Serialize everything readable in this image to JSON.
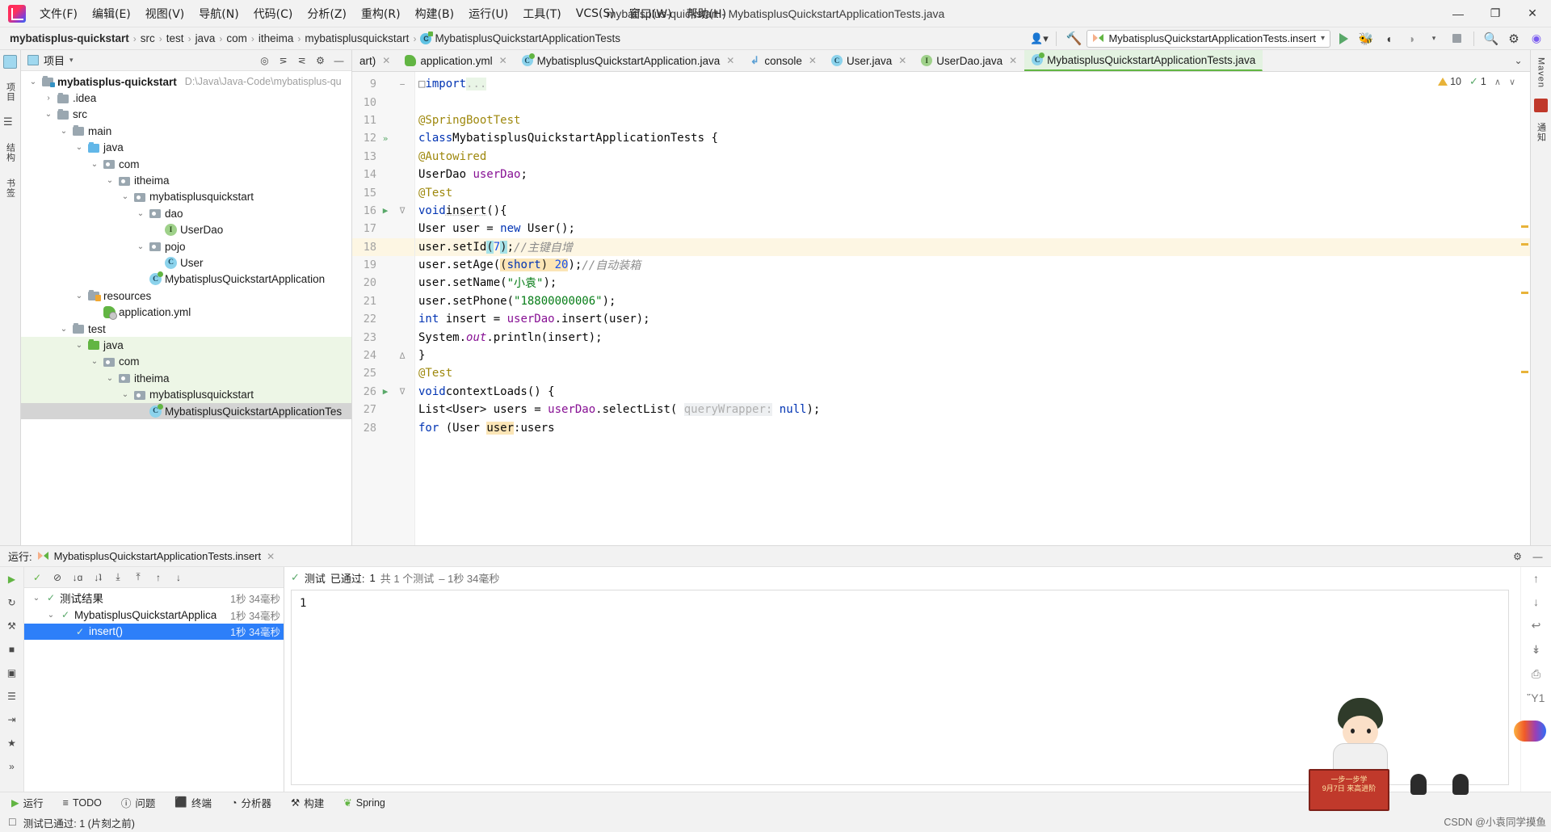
{
  "window": {
    "title": "mybatisplus-quickstart - MybatisplusQuickstartApplicationTests.java",
    "minimize": "—",
    "maximize": "❐",
    "close": "✕"
  },
  "menubar": {
    "items": [
      {
        "label": "文件(F)"
      },
      {
        "label": "编辑(E)"
      },
      {
        "label": "视图(V)"
      },
      {
        "label": "导航(N)"
      },
      {
        "label": "代码(C)"
      },
      {
        "label": "分析(Z)"
      },
      {
        "label": "重构(R)"
      },
      {
        "label": "构建(B)"
      },
      {
        "label": "运行(U)"
      },
      {
        "label": "工具(T)"
      },
      {
        "label": "VCS(S)"
      },
      {
        "label": "窗口(W)"
      },
      {
        "label": "帮助(H)"
      }
    ]
  },
  "navbar": {
    "breadcrumbs": [
      {
        "label": "mybatisplus-quickstart",
        "bold": true
      },
      {
        "label": "src",
        "bold": false
      },
      {
        "label": "test",
        "bold": false
      },
      {
        "label": "java",
        "bold": false
      },
      {
        "label": "com",
        "bold": false
      },
      {
        "label": "itheima",
        "bold": false
      },
      {
        "label": "mybatisplusquickstart",
        "bold": false
      },
      {
        "label": "MybatisplusQuickstartApplicationTests",
        "bold": false,
        "icon": "spring-class-icon"
      }
    ],
    "separator": "›",
    "run_config": "MybatisplusQuickstartApplicationTests.insert",
    "run_config_caret": "▾",
    "buttons": {
      "user_icon": "user-icon",
      "hammer_icon": "build-hammer-icon",
      "run_icon": "run-icon",
      "debug_icon": "debug-icon",
      "run_coverage_icon": "run-with-coverage-icon",
      "profiler_icon": "profiler-icon",
      "stop_icon": "stop-icon",
      "search_icon": "search-everywhere-icon",
      "settings_icon": "settings-gear-icon",
      "ai_icon": "ai-assistant-icon"
    }
  },
  "left_rail": {
    "items": [
      {
        "label": "项目",
        "icon": "project-icon"
      },
      {
        "label": "结构",
        "icon": "structure-icon"
      },
      {
        "label": "书签",
        "icon": "bookmarks-icon"
      }
    ]
  },
  "right_rail": {
    "items": [
      {
        "label": "Maven",
        "icon": "maven-icon"
      },
      {
        "label": "通知",
        "icon": "notifications-icon"
      }
    ]
  },
  "project_pane": {
    "title": "项目",
    "caret": "▾",
    "toolbar": {
      "locate_icon": "locate-file-icon",
      "expand_icon": "expand-all-icon",
      "collapse_icon": "collapse-all-icon",
      "settings_icon": "pane-settings-icon",
      "hide_icon": "hide-pane-icon"
    },
    "tree": [
      {
        "label": "mybatisplus-quickstart",
        "path": "D:\\Java\\Java-Code\\mybatisplus-qu",
        "indent": 0,
        "twisty": "⌄",
        "icon": "module-folder-icon",
        "bold": true,
        "state": "normal"
      },
      {
        "label": ".idea",
        "indent": 1,
        "twisty": "›",
        "icon": "folder-icon",
        "bold": false,
        "state": "normal"
      },
      {
        "label": "src",
        "indent": 1,
        "twisty": "⌄",
        "icon": "folder-icon",
        "bold": false,
        "state": "normal"
      },
      {
        "label": "main",
        "indent": 2,
        "twisty": "⌄",
        "icon": "folder-icon",
        "bold": false,
        "state": "normal"
      },
      {
        "label": "java",
        "indent": 3,
        "twisty": "⌄",
        "icon": "source-folder-blue-icon",
        "bold": false,
        "state": "normal"
      },
      {
        "label": "com",
        "indent": 4,
        "twisty": "⌄",
        "icon": "package-icon",
        "bold": false,
        "state": "normal"
      },
      {
        "label": "itheima",
        "indent": 5,
        "twisty": "⌄",
        "icon": "package-icon",
        "bold": false,
        "state": "normal"
      },
      {
        "label": "mybatisplusquickstart",
        "indent": 6,
        "twisty": "⌄",
        "icon": "package-icon",
        "bold": false,
        "state": "normal"
      },
      {
        "label": "dao",
        "indent": 7,
        "twisty": "⌄",
        "icon": "package-icon",
        "bold": false,
        "state": "normal"
      },
      {
        "label": "UserDao",
        "indent": 8,
        "twisty": "",
        "icon": "interface-icon",
        "bold": false,
        "state": "normal"
      },
      {
        "label": "pojo",
        "indent": 7,
        "twisty": "⌄",
        "icon": "package-icon",
        "bold": false,
        "state": "normal"
      },
      {
        "label": "User",
        "indent": 8,
        "twisty": "",
        "icon": "class-icon",
        "bold": false,
        "state": "normal"
      },
      {
        "label": "MybatisplusQuickstartApplication",
        "indent": 7,
        "twisty": "",
        "icon": "spring-class-icon",
        "bold": false,
        "state": "normal"
      },
      {
        "label": "resources",
        "indent": 3,
        "twisty": "⌄",
        "icon": "resources-folder-icon",
        "bold": false,
        "state": "normal"
      },
      {
        "label": "application.yml",
        "indent": 4,
        "twisty": "",
        "icon": "yml-spring-icon",
        "bold": false,
        "state": "normal"
      },
      {
        "label": "test",
        "indent": 2,
        "twisty": "⌄",
        "icon": "folder-icon",
        "bold": false,
        "state": "normal"
      },
      {
        "label": "java",
        "indent": 3,
        "twisty": "⌄",
        "icon": "test-source-folder-green-icon",
        "bold": false,
        "state": "test-highlight"
      },
      {
        "label": "com",
        "indent": 4,
        "twisty": "⌄",
        "icon": "package-icon",
        "bold": false,
        "state": "test-highlight"
      },
      {
        "label": "itheima",
        "indent": 5,
        "twisty": "⌄",
        "icon": "package-icon",
        "bold": false,
        "state": "test-highlight"
      },
      {
        "label": "mybatisplusquickstart",
        "indent": 6,
        "twisty": "⌄",
        "icon": "package-icon",
        "bold": false,
        "state": "test-highlight"
      },
      {
        "label": "MybatisplusQuickstartApplicationTes",
        "indent": 7,
        "twisty": "",
        "icon": "spring-class-icon",
        "bold": false,
        "state": "selected"
      }
    ]
  },
  "editor": {
    "tabs": [
      {
        "label": "art)",
        "icon": "",
        "closable": true,
        "active": false
      },
      {
        "label": "application.yml",
        "icon": "yml-spring-icon",
        "closable": true,
        "active": false
      },
      {
        "label": "MybatisplusQuickstartApplication.java",
        "icon": "spring-class-icon",
        "closable": true,
        "active": false
      },
      {
        "label": "console",
        "icon": "console-icon",
        "closable": true,
        "active": false
      },
      {
        "label": "User.java",
        "icon": "class-icon",
        "closable": true,
        "active": false
      },
      {
        "label": "UserDao.java",
        "icon": "interface-icon",
        "closable": true,
        "active": false
      },
      {
        "label": "MybatisplusQuickstartApplicationTests.java",
        "icon": "spring-class-icon",
        "closable": false,
        "active": true
      }
    ],
    "close_glyph": "✕",
    "inspections": {
      "warning_count": "10",
      "ok_count": "1",
      "warning_icon": "warning-triangle-icon",
      "check_icon": "inspection-check-icon",
      "chevron_up": "∧",
      "chevron_down": "∨"
    },
    "lines": [
      {
        "n": "9",
        "text_html": "partial",
        "gutter": "",
        "fold": "−",
        "hl": false
      },
      {
        "n": "10",
        "text_html": "blank",
        "gutter": "",
        "fold": "",
        "hl": false
      },
      {
        "n": "11",
        "text_html": "ann_springboottest",
        "gutter": "",
        "fold": "",
        "hl": false
      },
      {
        "n": "12",
        "text_html": "class_decl",
        "gutter": "»",
        "fold": "",
        "hl": false
      },
      {
        "n": "13",
        "text_html": "ann_autowired",
        "gutter": "",
        "fold": "",
        "hl": false
      },
      {
        "n": "14",
        "text_html": "userdao_field",
        "gutter": "",
        "fold": "",
        "hl": false
      },
      {
        "n": "15",
        "text_html": "ann_test",
        "gutter": "",
        "fold": "",
        "hl": false
      },
      {
        "n": "16",
        "text_html": "void_insert",
        "gutter": "▶",
        "fold": "∇",
        "hl": false
      },
      {
        "n": "17",
        "text_html": "new_user",
        "gutter": "",
        "fold": "",
        "hl": false
      },
      {
        "n": "18",
        "text_html": "set_id",
        "gutter": "",
        "fold": "",
        "hl": true
      },
      {
        "n": "19",
        "text_html": "set_age",
        "gutter": "",
        "fold": "",
        "hl": false
      },
      {
        "n": "20",
        "text_html": "set_name",
        "gutter": "",
        "fold": "",
        "hl": false
      },
      {
        "n": "21",
        "text_html": "set_phone",
        "gutter": "",
        "fold": "",
        "hl": false
      },
      {
        "n": "22",
        "text_html": "int_insert",
        "gutter": "",
        "fold": "",
        "hl": false
      },
      {
        "n": "23",
        "text_html": "println",
        "gutter": "",
        "fold": "",
        "hl": false
      },
      {
        "n": "24",
        "text_html": "close_brace",
        "gutter": "",
        "fold": "∆",
        "hl": false
      },
      {
        "n": "25",
        "text_html": "ann_test2",
        "gutter": "",
        "fold": "",
        "hl": false
      },
      {
        "n": "26",
        "text_html": "void_contextloads",
        "gutter": "▶",
        "fold": "∇",
        "hl": false
      },
      {
        "n": "27",
        "text_html": "list_users",
        "gutter": "",
        "fold": "",
        "hl": false
      },
      {
        "n": "28",
        "text_html": "for_loop",
        "gutter": "",
        "fold": "",
        "hl": false
      }
    ],
    "source_text": {
      "l9": "import ...",
      "l11": "@SpringBootTest",
      "l12": "class MybatisplusQuickstartApplicationTests {",
      "l13": "@Autowired",
      "l14": "UserDao userDao;",
      "l15": "@Test",
      "l16": "void insert(){",
      "l17": "User user = new User();",
      "l18": "user.setId(7);//主键自增",
      "l19": "user.setAge((short) 20);//自动装箱",
      "l20": "user.setName(\"小袁\");",
      "l21": "user.setPhone(\"18800000006\");",
      "l22": "int insert = userDao.insert(user);",
      "l23": "System.out.println(insert);",
      "l24": "}",
      "l25": "@Test",
      "l26": "void contextLoads() {",
      "l27": "List<User> users = userDao.selectList( queryWrapper: null);",
      "l28": "for (User user:users"
    }
  },
  "run_pane": {
    "header": {
      "label": "运行:",
      "config_name": "MybatisplusQuickstartApplicationTests.insert",
      "close_glyph": "✕",
      "settings_icon": "run-settings-icon",
      "hide_icon": "hide-run-pane-icon"
    },
    "left_toolbar": [
      {
        "icon": "rerun-icon",
        "glyph": "▶"
      },
      {
        "icon": "rerun-failed-icon",
        "glyph": "↻"
      },
      {
        "icon": "wrench-icon",
        "glyph": "⚒"
      },
      {
        "icon": "stop-icon",
        "glyph": "■"
      },
      {
        "icon": "camera-icon",
        "glyph": "▣"
      },
      {
        "icon": "thread-dump-icon",
        "glyph": "☰"
      },
      {
        "icon": "export-icon",
        "glyph": "⇥"
      },
      {
        "icon": "pin-icon",
        "glyph": "★"
      },
      {
        "icon": "more-icon",
        "glyph": "»"
      }
    ],
    "tests_toolbar": [
      {
        "icon": "show-passed-icon",
        "glyph": "✓"
      },
      {
        "icon": "show-ignored-icon",
        "glyph": "⊘"
      },
      {
        "icon": "sort-alpha-icon",
        "glyph": "↓ɑ"
      },
      {
        "icon": "sort-duration-icon",
        "glyph": "↓ʇ"
      },
      {
        "icon": "expand-all-icon",
        "glyph": "⤓"
      },
      {
        "icon": "collapse-all-icon",
        "glyph": "⤒"
      },
      {
        "icon": "prev-test-icon",
        "glyph": "↑"
      },
      {
        "icon": "next-test-icon",
        "glyph": "↓"
      }
    ],
    "tests_tree": [
      {
        "label": "测试结果",
        "duration": "1秒 34毫秒",
        "indent": 0,
        "twisty": "⌄",
        "selected": false
      },
      {
        "label": "MybatisplusQuickstartApplica",
        "duration": "1秒 34毫秒",
        "indent": 1,
        "twisty": "⌄",
        "selected": false
      },
      {
        "label": "insert()",
        "duration": "1秒 34毫秒",
        "indent": 2,
        "twisty": "",
        "selected": true
      }
    ],
    "status_line": {
      "check_icon": "test-passed-check-icon",
      "prefix": "测试",
      "passed": "已通过:",
      "count": "1",
      "total_label": "共 1 个测试",
      "duration": "– 1秒 34毫秒"
    },
    "console_output": "1",
    "console_rail": [
      {
        "icon": "scroll-up-icon",
        "glyph": "↑"
      },
      {
        "icon": "scroll-down-icon",
        "glyph": "↓"
      },
      {
        "icon": "soft-wrap-icon",
        "glyph": "↩"
      },
      {
        "icon": "scroll-to-end-icon",
        "glyph": "↡"
      },
      {
        "icon": "print-icon",
        "glyph": "⎙"
      },
      {
        "icon": "clear-all-icon",
        "glyph": "Ὕ1"
      }
    ]
  },
  "bottom_tabs": [
    {
      "label": "运行",
      "icon": "run-tab-icon",
      "glyph": "▶"
    },
    {
      "label": "TODO",
      "icon": "todo-tab-icon",
      "glyph": "≡"
    },
    {
      "label": "问题",
      "icon": "problems-tab-icon",
      "glyph": "ⓘ"
    },
    {
      "label": "终端",
      "icon": "terminal-tab-icon",
      "glyph": "⬛"
    },
    {
      "label": "分析器",
      "icon": "profiler-tab-icon",
      "glyph": "◔"
    },
    {
      "label": "构建",
      "icon": "build-tab-icon",
      "glyph": "⚒"
    },
    {
      "label": "Spring",
      "icon": "spring-tab-icon",
      "glyph": "❦"
    }
  ],
  "statusbar": {
    "icon": "event-log-icon",
    "message": "测试已通过: 1 (片刻之前)"
  },
  "watermark": {
    "banner_line1": "一步一步学",
    "banner_line2": "9月7日  来高进阶",
    "csdn_text": "CSDN @小袁同学摸鱼"
  },
  "colors": {
    "accent_green": "#62b543",
    "selection_blue": "#2d7ff9",
    "test_source_bg": "#edf6e6",
    "highlight_line": "#fdf6e3",
    "string_green": "#067d17",
    "keyword_blue": "#0033b3",
    "annotation_gold": "#9e880d",
    "field_purple": "#871094"
  }
}
